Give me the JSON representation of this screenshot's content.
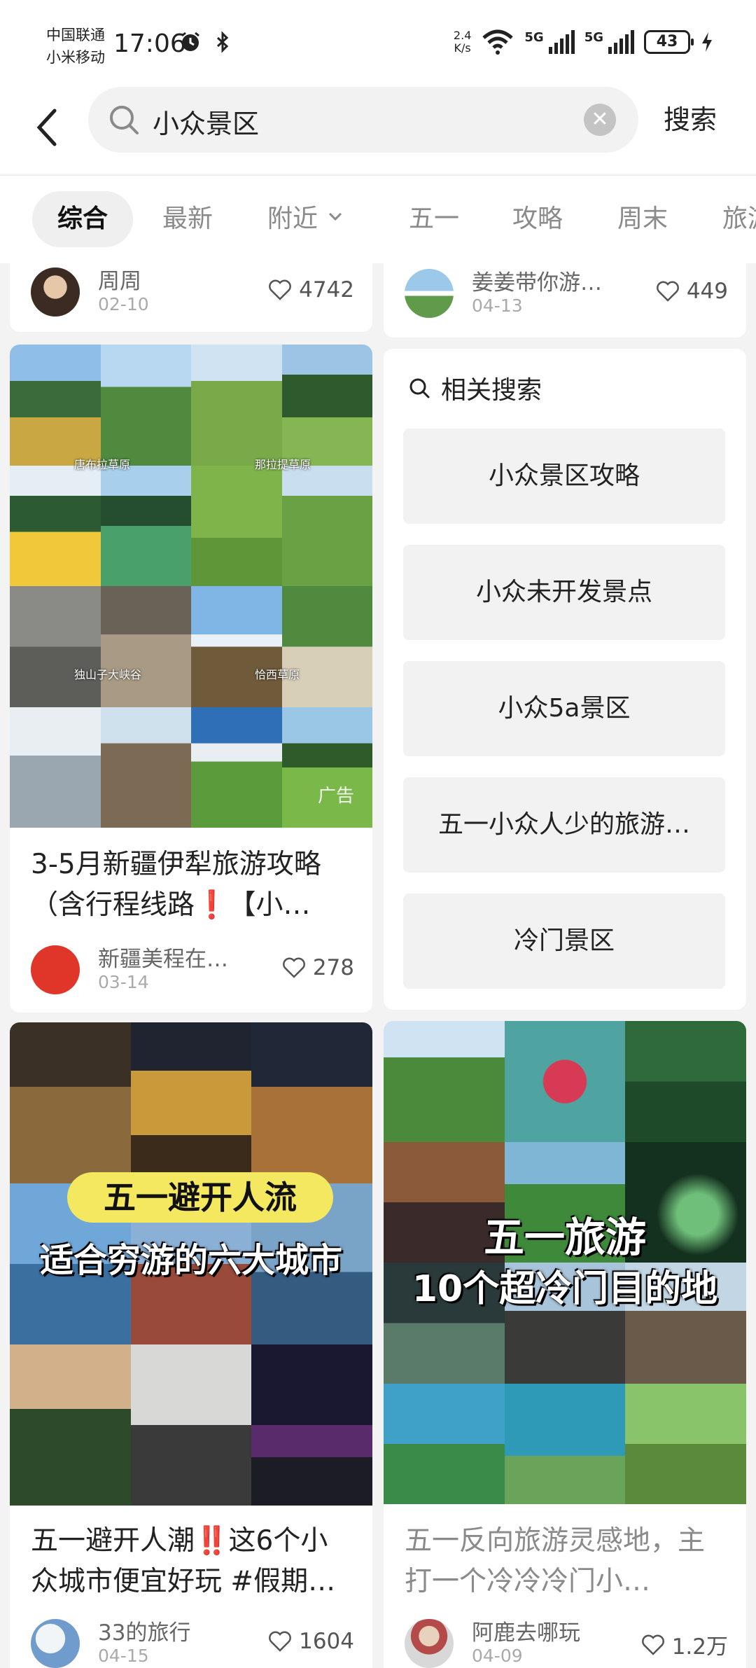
{
  "status_bar": {
    "carrier_1": "中国联通",
    "carrier_2": "小米移动",
    "time": "17:06",
    "net_speed_value": "2.4",
    "net_speed_unit": "K/s",
    "sig1_label": "5G",
    "sig2_label": "5G",
    "battery": "43"
  },
  "search": {
    "query": "小众景区",
    "button_label": "搜索"
  },
  "tabs": [
    {
      "label": "综合"
    },
    {
      "label": "最新"
    },
    {
      "label": "附近"
    },
    {
      "label": "五一"
    },
    {
      "label": "攻略"
    },
    {
      "label": "周末"
    },
    {
      "label": "旅游"
    }
  ],
  "feed": {
    "top_left": {
      "author": "周周",
      "date": "02-10",
      "likes": "4742"
    },
    "top_right": {
      "author": "姜姜带你游…",
      "date": "04-13",
      "likes": "449"
    },
    "card1": {
      "title": "3-5月新疆伊犁旅游攻略（含行程线路❗️【小…",
      "author": "新疆美程在…",
      "date": "03-14",
      "likes": "278",
      "ad": "广告",
      "captions": [
        "唐布拉草原",
        "那拉提草原",
        "独山子大峡谷",
        "恰西草原"
      ]
    },
    "related": {
      "title": "相关搜索",
      "items": [
        "小众景区攻略",
        "小众未开发景点",
        "小众5a景区",
        "五一小众人少的旅游…",
        "冷门景区"
      ]
    },
    "card2": {
      "banner": "五一避开人流",
      "subtitle": "适合穷游的六大城市",
      "title": "五一避开人潮‼️这6个小众城市便宜好玩 #假期…",
      "author": "33的旅行",
      "date": "04-15",
      "likes": "1604"
    },
    "card3": {
      "banner1": "五一旅游",
      "banner2": "10个超冷门目的地",
      "title": "五一反向旅游灵感地，主打一个冷冷冷门小…",
      "author": "阿鹿去哪玩",
      "date": "04-09",
      "likes": "1.2万"
    }
  }
}
